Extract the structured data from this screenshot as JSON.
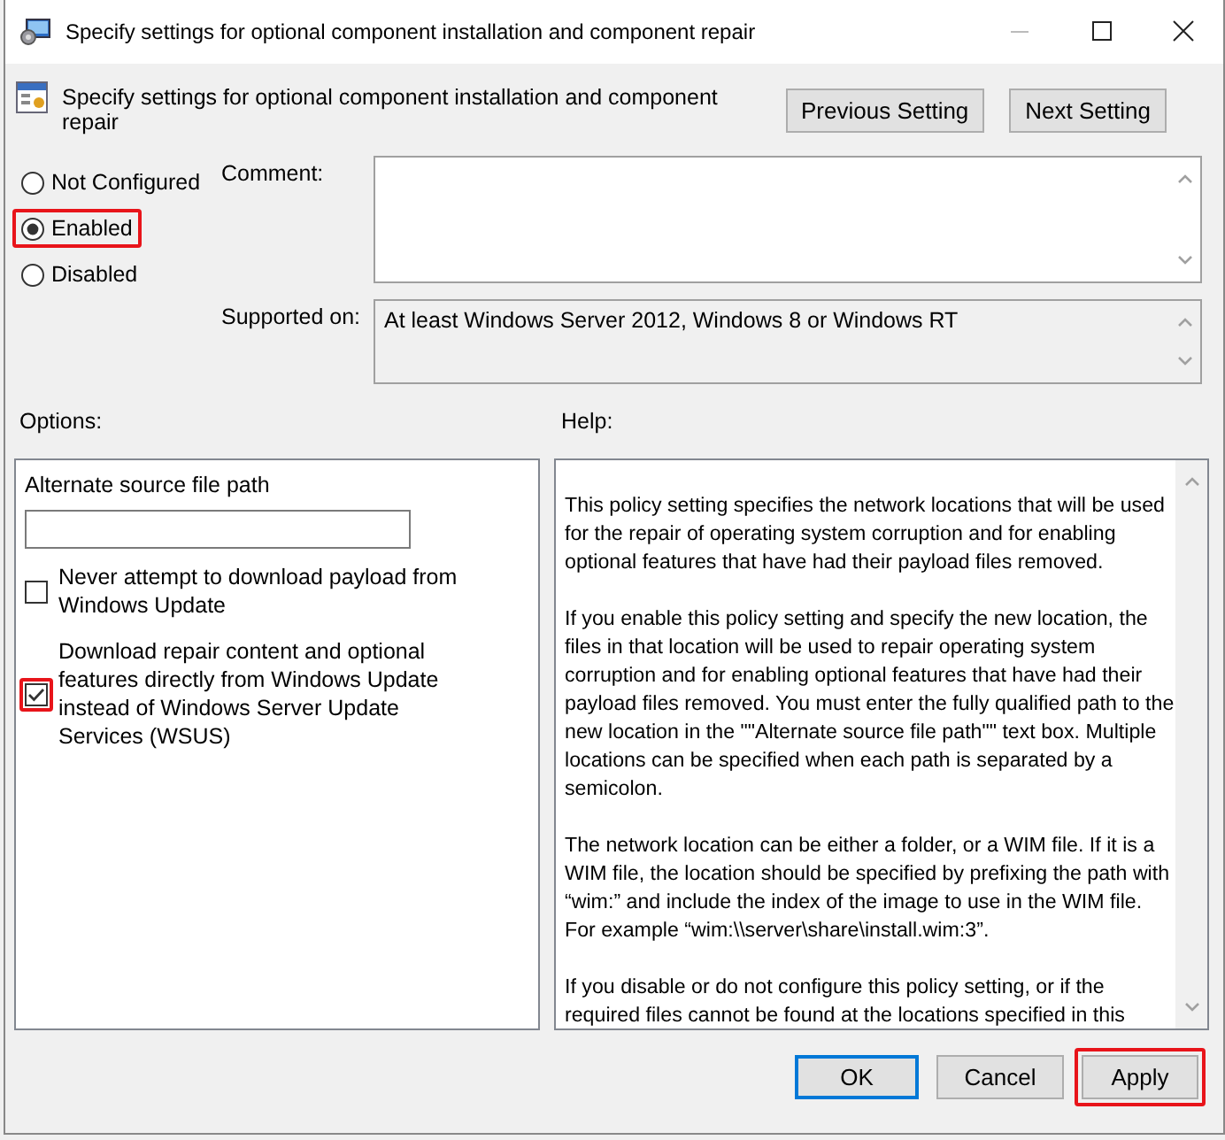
{
  "window": {
    "title": "Specify settings for optional component installation and component repair"
  },
  "header": {
    "title": "Specify settings for optional component installation and component repair",
    "buttons": [
      {
        "label": "Previous Setting"
      },
      {
        "label": "Next Setting"
      }
    ]
  },
  "state_options": [
    {
      "label": "Not Configured",
      "selected": false,
      "highlighted": false
    },
    {
      "label": "Enabled",
      "selected": true,
      "highlighted": true
    },
    {
      "label": "Disabled",
      "selected": false,
      "highlighted": false
    }
  ],
  "comment": {
    "label": "Comment:"
  },
  "supported_on": {
    "label": "Supported on:",
    "value": "At least Windows Server 2012, Windows 8 or Windows RT"
  },
  "options": {
    "heading": "Options:",
    "path_field": {
      "label": "Alternate source file path"
    },
    "checkboxes": [
      {
        "label": "Never attempt to download payload from Windows Update",
        "checked": false,
        "highlighted": false
      },
      {
        "label": "Download repair content and optional features directly from Windows Update instead of Windows Server Update Services (WSUS)",
        "checked": true,
        "highlighted": true
      }
    ]
  },
  "help": {
    "heading": "Help:",
    "paragraphs": [
      "This policy setting specifies the network locations that will be used for the repair of operating system corruption and for enabling optional features that have had their payload files removed.",
      "If you enable this policy setting and specify the new location, the files in that location will be used to repair operating system corruption and for enabling optional features that have had their payload files removed. You must enter the fully qualified path to the new location in the \"\"Alternate source file path\"\" text box. Multiple locations can be specified when each path is separated by a semicolon.",
      "The network location can be either a folder, or a WIM file. If it is a WIM file, the location should be specified by prefixing the path with “wim:” and include the index of the image to use in the WIM file. For example “wim:\\\\server\\share\\install.wim:3”.",
      "If you disable or do not configure this policy setting, or if the required files cannot be found at the locations specified in this"
    ]
  },
  "buttons": [
    {
      "label": "OK",
      "default": true,
      "highlighted": false
    },
    {
      "label": "Cancel",
      "default": false,
      "highlighted": false
    },
    {
      "label": "Apply",
      "default": false,
      "highlighted": true
    }
  ]
}
